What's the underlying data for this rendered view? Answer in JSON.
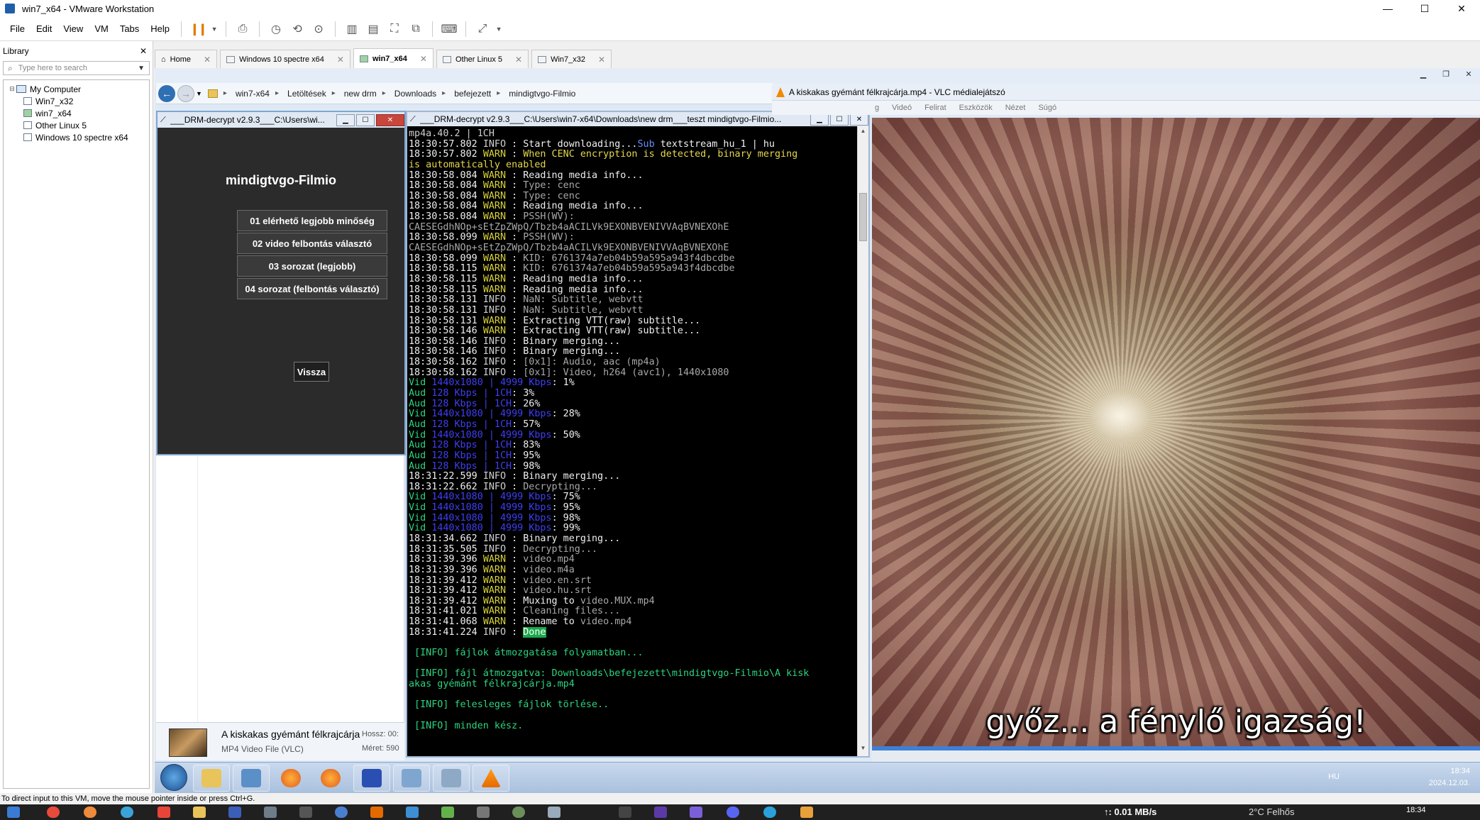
{
  "host": {
    "title": "win7_x64 - VMware Workstation",
    "menu": [
      "File",
      "Edit",
      "View",
      "VM",
      "Tabs",
      "Help"
    ],
    "status_text": "To direct input to this VM, move the mouse pointer inside or press Ctrl+G."
  },
  "library": {
    "title": "Library",
    "close": "✕",
    "search_placeholder": "Type here to search",
    "root": "My Computer",
    "vms": [
      "Win7_x32",
      "win7_x64",
      "Other Linux 5",
      "Windows 10 spectre x64"
    ]
  },
  "tabs": [
    {
      "label": "Home",
      "active": false
    },
    {
      "label": "Windows 10 spectre x64",
      "active": false
    },
    {
      "label": "win7_x64",
      "active": true
    },
    {
      "label": "Other Linux 5",
      "active": false
    },
    {
      "label": "Win7_x32",
      "active": false
    }
  ],
  "explorer": {
    "breadcrumb": [
      "win7-x64",
      "Letöltések",
      "new drm",
      "Downloads",
      "befejezett",
      "mindigtvgo-Filmio"
    ],
    "details": {
      "file_name": "A kiskakas gyémánt félkrajcárja",
      "file_type": "MP4 Video File (VLC)",
      "meta1": "Hossz: 00:",
      "meta2": "Méret: 590"
    }
  },
  "drm_gui": {
    "title": "___DRM-decrypt v2.9.3___C:\\Users\\wi...",
    "heading": "mindigtvgo-Filmio",
    "options": [
      "01 elérhető legjobb minőség",
      "02 video felbontás választó",
      "03 sorozat (legjobb)",
      "04 sorozat (felbontás választó)"
    ],
    "back_label": "Vissza"
  },
  "console": {
    "title": "___DRM-decrypt v2.9.3___C:\\Users\\win7-x64\\Downloads\\new drm___teszt mindigtvgo-Filmio...",
    "lines": [
      [
        {
          "t": "mp4a.40.2 | 1CH",
          "c": "info"
        }
      ],
      [
        {
          "t": "18:30:57.802 ",
          "c": ""
        },
        {
          "t": "INFO",
          "c": "info"
        },
        {
          "t": " : Start downloading...",
          "c": ""
        },
        {
          "t": "Sub",
          "c": "sub"
        },
        {
          "t": " textstream_hu_1 | hu",
          "c": ""
        }
      ],
      [
        {
          "t": "18:30:57.802 ",
          "c": ""
        },
        {
          "t": "WARN",
          "c": "warn"
        },
        {
          "t": " : ",
          "c": ""
        },
        {
          "t": "When CENC encryption is detected, binary merging",
          "c": "yellowmsg"
        }
      ],
      [
        {
          "t": "is automatically enabled",
          "c": "yellowmsg"
        }
      ],
      [
        {
          "t": "18:30:58.084 ",
          "c": ""
        },
        {
          "t": "WARN",
          "c": "warn"
        },
        {
          "t": " : Reading media info...",
          "c": ""
        }
      ],
      [
        {
          "t": "18:30:58.084 ",
          "c": ""
        },
        {
          "t": "WARN",
          "c": "warn"
        },
        {
          "t": " : ",
          "c": ""
        },
        {
          "t": "Type: cenc",
          "c": "dim"
        }
      ],
      [
        {
          "t": "18:30:58.084 ",
          "c": ""
        },
        {
          "t": "WARN",
          "c": "warn"
        },
        {
          "t": " : ",
          "c": ""
        },
        {
          "t": "Type: cenc",
          "c": "dim"
        }
      ],
      [
        {
          "t": "18:30:58.084 ",
          "c": ""
        },
        {
          "t": "WARN",
          "c": "warn"
        },
        {
          "t": " : Reading media info...",
          "c": ""
        }
      ],
      [
        {
          "t": "18:30:58.084 ",
          "c": ""
        },
        {
          "t": "WARN",
          "c": "warn"
        },
        {
          "t": " : ",
          "c": ""
        },
        {
          "t": "PSSH(WV):",
          "c": "dim"
        }
      ],
      [
        {
          "t": "CAESEGdhNOp+sEtZpZWpQ/Tbzb4aACILVk9EXONBVENIVVAqBVNEXOhE",
          "c": "dim"
        }
      ],
      [
        {
          "t": "18:30:58.099 ",
          "c": ""
        },
        {
          "t": "WARN",
          "c": "warn"
        },
        {
          "t": " : ",
          "c": ""
        },
        {
          "t": "PSSH(WV):",
          "c": "dim"
        }
      ],
      [
        {
          "t": "CAESEGdhNOp+sEtZpZWpQ/Tbzb4aACILVk9EXONBVENIVVAqBVNEXOhE",
          "c": "dim"
        }
      ],
      [
        {
          "t": "18:30:58.099 ",
          "c": ""
        },
        {
          "t": "WARN",
          "c": "warn"
        },
        {
          "t": " : ",
          "c": ""
        },
        {
          "t": "KID: 6761374a7eb04b59a595a943f4dbcdbe",
          "c": "dim"
        }
      ],
      [
        {
          "t": "18:30:58.115 ",
          "c": ""
        },
        {
          "t": "WARN",
          "c": "warn"
        },
        {
          "t": " : ",
          "c": ""
        },
        {
          "t": "KID: 6761374a7eb04b59a595a943f4dbcdbe",
          "c": "dim"
        }
      ],
      [
        {
          "t": "18:30:58.115 ",
          "c": ""
        },
        {
          "t": "WARN",
          "c": "warn"
        },
        {
          "t": " : Reading media info...",
          "c": ""
        }
      ],
      [
        {
          "t": "18:30:58.115 ",
          "c": ""
        },
        {
          "t": "WARN",
          "c": "warn"
        },
        {
          "t": " : Reading media info...",
          "c": ""
        }
      ],
      [
        {
          "t": "18:30:58.131 ",
          "c": ""
        },
        {
          "t": "INFO",
          "c": "info"
        },
        {
          "t": " : ",
          "c": ""
        },
        {
          "t": "NaN: Subtitle, webvtt",
          "c": "dim"
        }
      ],
      [
        {
          "t": "18:30:58.131 ",
          "c": ""
        },
        {
          "t": "INFO",
          "c": "info"
        },
        {
          "t": " : ",
          "c": ""
        },
        {
          "t": "NaN: Subtitle, webvtt",
          "c": "dim"
        }
      ],
      [
        {
          "t": "18:30:58.131 ",
          "c": ""
        },
        {
          "t": "WARN",
          "c": "warn"
        },
        {
          "t": " : Extracting VTT(raw) subtitle...",
          "c": ""
        }
      ],
      [
        {
          "t": "18:30:58.146 ",
          "c": ""
        },
        {
          "t": "WARN",
          "c": "warn"
        },
        {
          "t": " : Extracting VTT(raw) subtitle...",
          "c": ""
        }
      ],
      [
        {
          "t": "18:30:58.146 ",
          "c": ""
        },
        {
          "t": "INFO",
          "c": "info"
        },
        {
          "t": " : Binary merging...",
          "c": ""
        }
      ],
      [
        {
          "t": "18:30:58.146 ",
          "c": ""
        },
        {
          "t": "INFO",
          "c": "info"
        },
        {
          "t": " : Binary merging...",
          "c": ""
        }
      ],
      [
        {
          "t": "18:30:58.162 ",
          "c": ""
        },
        {
          "t": "INFO",
          "c": "info"
        },
        {
          "t": " : ",
          "c": ""
        },
        {
          "t": "[0x1]: Audio, aac (mp4a)",
          "c": "dim"
        }
      ],
      [
        {
          "t": "18:30:58.162 ",
          "c": ""
        },
        {
          "t": "INFO",
          "c": "info"
        },
        {
          "t": " : ",
          "c": ""
        },
        {
          "t": "[0x1]: Video, h264 (avc1), 1440x1080",
          "c": "dim"
        }
      ],
      [
        {
          "t": "Vid ",
          "c": "green"
        },
        {
          "t": "1440x1080 | 4999 Kbps",
          "c": "blue"
        },
        {
          "t": ": 1%",
          "c": ""
        }
      ],
      [
        {
          "t": "Aud ",
          "c": "green"
        },
        {
          "t": "128 Kbps | 1CH",
          "c": "blue"
        },
        {
          "t": ": 3%",
          "c": ""
        }
      ],
      [
        {
          "t": "Aud ",
          "c": "green"
        },
        {
          "t": "128 Kbps | 1CH",
          "c": "blue"
        },
        {
          "t": ": 26%",
          "c": ""
        }
      ],
      [
        {
          "t": "Vid ",
          "c": "green"
        },
        {
          "t": "1440x1080 | 4999 Kbps",
          "c": "blue"
        },
        {
          "t": ": 28%",
          "c": ""
        }
      ],
      [
        {
          "t": "Aud ",
          "c": "green"
        },
        {
          "t": "128 Kbps | 1CH",
          "c": "blue"
        },
        {
          "t": ": 57%",
          "c": ""
        }
      ],
      [
        {
          "t": "Vid ",
          "c": "green"
        },
        {
          "t": "1440x1080 | 4999 Kbps",
          "c": "blue"
        },
        {
          "t": ": 50%",
          "c": ""
        }
      ],
      [
        {
          "t": "Aud ",
          "c": "green"
        },
        {
          "t": "128 Kbps | 1CH",
          "c": "blue"
        },
        {
          "t": ": 83%",
          "c": ""
        }
      ],
      [
        {
          "t": "Aud ",
          "c": "green"
        },
        {
          "t": "128 Kbps | 1CH",
          "c": "blue"
        },
        {
          "t": ": 95%",
          "c": ""
        }
      ],
      [
        {
          "t": "Aud ",
          "c": "green"
        },
        {
          "t": "128 Kbps | 1CH",
          "c": "blue"
        },
        {
          "t": ": 98%",
          "c": ""
        }
      ],
      [
        {
          "t": "18:31:22.599 ",
          "c": ""
        },
        {
          "t": "INFO",
          "c": "info"
        },
        {
          "t": " : Binary merging...",
          "c": ""
        }
      ],
      [
        {
          "t": "18:31:22.662 ",
          "c": ""
        },
        {
          "t": "INFO",
          "c": "info"
        },
        {
          "t": " : ",
          "c": ""
        },
        {
          "t": "Decrypting...",
          "c": "dim"
        }
      ],
      [
        {
          "t": "Vid ",
          "c": "green"
        },
        {
          "t": "1440x1080 | 4999 Kbps",
          "c": "blue"
        },
        {
          "t": ": 75%",
          "c": ""
        }
      ],
      [
        {
          "t": "Vid ",
          "c": "green"
        },
        {
          "t": "1440x1080 | 4999 Kbps",
          "c": "blue"
        },
        {
          "t": ": 95%",
          "c": ""
        }
      ],
      [
        {
          "t": "Vid ",
          "c": "green"
        },
        {
          "t": "1440x1080 | 4999 Kbps",
          "c": "blue"
        },
        {
          "t": ": 98%",
          "c": ""
        }
      ],
      [
        {
          "t": "Vid ",
          "c": "green"
        },
        {
          "t": "1440x1080 | 4999 Kbps",
          "c": "blue"
        },
        {
          "t": ": 99%",
          "c": ""
        }
      ],
      [
        {
          "t": "18:31:34.662 ",
          "c": ""
        },
        {
          "t": "INFO",
          "c": "info"
        },
        {
          "t": " : Binary merging...",
          "c": ""
        }
      ],
      [
        {
          "t": "18:31:35.505 ",
          "c": ""
        },
        {
          "t": "INFO",
          "c": "info"
        },
        {
          "t": " : ",
          "c": ""
        },
        {
          "t": "Decrypting...",
          "c": "dim"
        }
      ],
      [
        {
          "t": "18:31:39.396 ",
          "c": ""
        },
        {
          "t": "WARN",
          "c": "warn"
        },
        {
          "t": " : ",
          "c": ""
        },
        {
          "t": "video.mp4",
          "c": "dim"
        }
      ],
      [
        {
          "t": "18:31:39.396 ",
          "c": ""
        },
        {
          "t": "WARN",
          "c": "warn"
        },
        {
          "t": " : ",
          "c": ""
        },
        {
          "t": "video.m4a",
          "c": "dim"
        }
      ],
      [
        {
          "t": "18:31:39.412 ",
          "c": ""
        },
        {
          "t": "WARN",
          "c": "warn"
        },
        {
          "t": " : ",
          "c": ""
        },
        {
          "t": "video.en.srt",
          "c": "dim"
        }
      ],
      [
        {
          "t": "18:31:39.412 ",
          "c": ""
        },
        {
          "t": "WARN",
          "c": "warn"
        },
        {
          "t": " : ",
          "c": ""
        },
        {
          "t": "video.hu.srt",
          "c": "dim"
        }
      ],
      [
        {
          "t": "18:31:39.412 ",
          "c": ""
        },
        {
          "t": "WARN",
          "c": "warn"
        },
        {
          "t": " : Muxing to ",
          "c": ""
        },
        {
          "t": "video.MUX.mp4",
          "c": "dim"
        }
      ],
      [
        {
          "t": "18:31:41.021 ",
          "c": ""
        },
        {
          "t": "WARN",
          "c": "warn"
        },
        {
          "t": " : ",
          "c": ""
        },
        {
          "t": "Cleaning files...",
          "c": "dim"
        }
      ],
      [
        {
          "t": "18:31:41.068 ",
          "c": ""
        },
        {
          "t": "WARN",
          "c": "warn"
        },
        {
          "t": " : Rename to ",
          "c": ""
        },
        {
          "t": "video.mp4",
          "c": "dim"
        }
      ],
      [
        {
          "t": "18:31:41.224 ",
          "c": ""
        },
        {
          "t": "INFO",
          "c": "info"
        },
        {
          "t": " : ",
          "c": ""
        },
        {
          "t": "Done",
          "c": "done"
        }
      ],
      [
        {
          "t": "",
          "c": ""
        }
      ],
      [
        {
          "t": " [INFO] fájlok átmozgatása folyamatban...",
          "c": "green"
        }
      ],
      [
        {
          "t": "",
          "c": ""
        }
      ],
      [
        {
          "t": " [INFO] fájl átmozgatva: Downloads\\befejezett\\mindigtvgo-Filmio\\A kisk",
          "c": "green"
        }
      ],
      [
        {
          "t": "akas gyémánt félkrajcárja.mp4",
          "c": "green"
        }
      ],
      [
        {
          "t": "",
          "c": ""
        }
      ],
      [
        {
          "t": " [INFO] felesleges fájlok törlése..",
          "c": "green"
        }
      ],
      [
        {
          "t": "",
          "c": ""
        }
      ],
      [
        {
          "t": " [INFO] minden kész.",
          "c": "green"
        }
      ],
      [
        {
          "t": "",
          "c": ""
        }
      ],
      [
        {
          "t": "",
          "c": ""
        }
      ],
      [
        {
          "t": "=============================================================",
          "c": "blue"
        }
      ]
    ]
  },
  "vlc": {
    "title": "A kiskakas gyémánt félkrajcárja.mp4 - VLC médialejátszó",
    "menus": [
      "g",
      "Videó",
      "Felirat",
      "Eszközök",
      "Nézet",
      "Súgó"
    ],
    "subtitle": "győz... a fénylő igazság!"
  },
  "guest_tray": {
    "lang": "HU",
    "time": "18:34",
    "date": "2024.12.03."
  },
  "host_taskbar": {
    "net_speed": "↑: 0.01 MB/s",
    "weather": "2°C  Felhős",
    "time": "18:34"
  }
}
